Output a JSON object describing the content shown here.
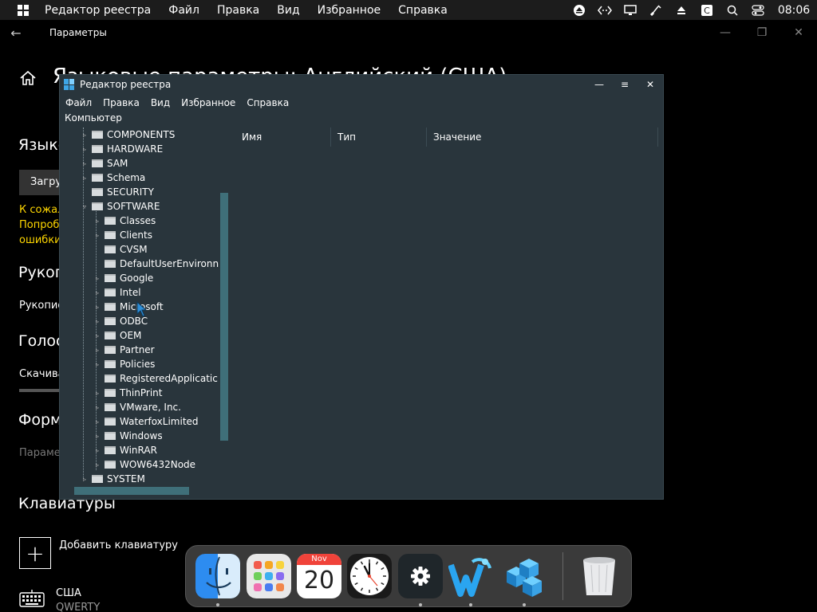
{
  "menubar": {
    "app_name": "Редактор реестра",
    "items": [
      "Файл",
      "Правка",
      "Вид",
      "Избранное",
      "Справка"
    ],
    "tray_icons": [
      "eject-icon",
      "code-icon",
      "monitor-icon",
      "brush-icon",
      "upload-icon",
      "c-icon",
      "search-icon",
      "toggle-icon"
    ],
    "clock": "08:06"
  },
  "settings": {
    "window_title": "Параметры",
    "page_title": "Языковые параметры: Английский (США)",
    "section_language": "Языко",
    "button_download": "Загру",
    "warning_lines": [
      "К сожал",
      "Попроб",
      "ошибки"
    ],
    "section_handwriting": "Рукоп",
    "handwriting_text": "Рукопис",
    "section_voice": "Голос",
    "voice_text": "Скачива",
    "section_formats": "Форм",
    "formats_text": "Параме",
    "section_keyboards": "Клавиатуры",
    "add_keyboard": "Добавить клавиатуру",
    "keyboard_name": "США",
    "keyboard_layout": "QWERTY"
  },
  "regedit": {
    "title": "Редактор реестра",
    "menu": [
      "Файл",
      "Правка",
      "Вид",
      "Избранное",
      "Справка"
    ],
    "address": "Компьютер",
    "columns": [
      "Имя",
      "Тип",
      "Значение"
    ],
    "tree": [
      {
        "label": "COMPONENTS",
        "level": 1,
        "expandable": true
      },
      {
        "label": "HARDWARE",
        "level": 1,
        "expandable": true
      },
      {
        "label": "SAM",
        "level": 1,
        "expandable": true
      },
      {
        "label": "Schema",
        "level": 1,
        "expandable": true
      },
      {
        "label": "SECURITY",
        "level": 1,
        "expandable": false
      },
      {
        "label": "SOFTWARE",
        "level": 1,
        "expandable": true,
        "expanded": true
      },
      {
        "label": "Classes",
        "level": 2,
        "expandable": true
      },
      {
        "label": "Clients",
        "level": 2,
        "expandable": true
      },
      {
        "label": "CVSM",
        "level": 2,
        "expandable": false
      },
      {
        "label": "DefaultUserEnvironn",
        "level": 2,
        "expandable": false
      },
      {
        "label": "Google",
        "level": 2,
        "expandable": true
      },
      {
        "label": "Intel",
        "level": 2,
        "expandable": true
      },
      {
        "label": "Microsoft",
        "level": 2,
        "expandable": true
      },
      {
        "label": "ODBC",
        "level": 2,
        "expandable": true
      },
      {
        "label": "OEM",
        "level": 2,
        "expandable": true
      },
      {
        "label": "Partner",
        "level": 2,
        "expandable": true
      },
      {
        "label": "Policies",
        "level": 2,
        "expandable": true
      },
      {
        "label": "RegisteredApplicatic",
        "level": 2,
        "expandable": false
      },
      {
        "label": "ThinPrint",
        "level": 2,
        "expandable": true
      },
      {
        "label": "VMware, Inc.",
        "level": 2,
        "expandable": true
      },
      {
        "label": "WaterfoxLimited",
        "level": 2,
        "expandable": true
      },
      {
        "label": "Windows",
        "level": 2,
        "expandable": true
      },
      {
        "label": "WinRAR",
        "level": 2,
        "expandable": true
      },
      {
        "label": "WOW6432Node",
        "level": 2,
        "expandable": true
      },
      {
        "label": "SYSTEM",
        "level": 1,
        "expandable": true
      }
    ]
  },
  "dock": {
    "apps": [
      "finder-icon",
      "launchpad-icon",
      "calendar-icon",
      "clock-icon",
      "settings-icon",
      "waterfox-icon",
      "regedit-icon",
      "trash-icon"
    ],
    "calendar_month": "Nov",
    "calendar_day": "20"
  }
}
